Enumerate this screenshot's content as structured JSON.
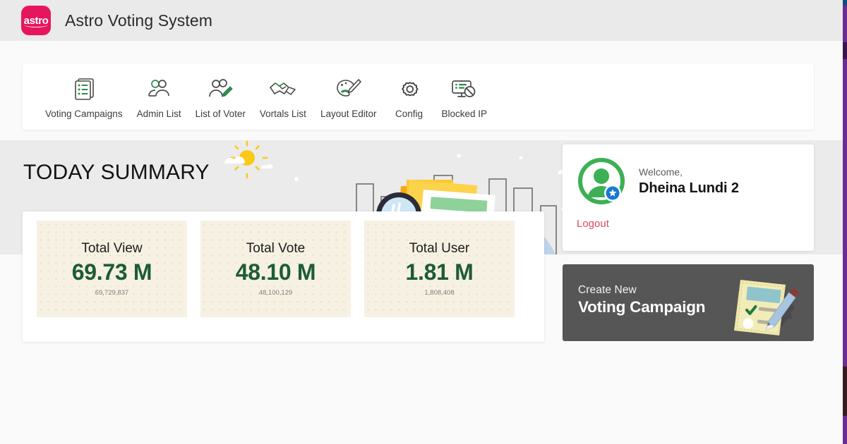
{
  "header": {
    "logo_text": "astro",
    "logo_color": "#e6165e",
    "title": "Astro Voting System"
  },
  "nav": {
    "items": [
      {
        "label": "Voting Campaigns",
        "icon": "documents-list-icon"
      },
      {
        "label": "Admin List",
        "icon": "users-admin-icon"
      },
      {
        "label": "List of Voter",
        "icon": "user-edit-icon"
      },
      {
        "label": "Vortals List",
        "icon": "handshake-icon"
      },
      {
        "label": "Layout Editor",
        "icon": "paint-palette-icon"
      },
      {
        "label": "Config",
        "icon": "gear-icon"
      },
      {
        "label": "Blocked IP",
        "icon": "monitor-blocked-icon"
      }
    ]
  },
  "hero": {
    "title": "TODAY SUMMARY"
  },
  "summary": {
    "stats": [
      {
        "label": "Total View",
        "value": "69.73 M",
        "exact": "69,729,837"
      },
      {
        "label": "Total Vote",
        "value": "48.10 M",
        "exact": "48,100,129"
      },
      {
        "label": "Total User",
        "value": "1.81 M",
        "exact": "1,808,408"
      }
    ],
    "value_color": "#1c5c34",
    "card_bg": "#f6f1e2"
  },
  "welcome": {
    "greeting": "Welcome,",
    "user_name": "Dheina Lundi 2",
    "logout_label": "Logout",
    "logout_color": "#e2485e",
    "avatar_icon": "user-avatar-verified-icon",
    "avatar_color": "#3cb054",
    "badge_color": "#1778d4"
  },
  "create_campaign": {
    "kicker": "Create New",
    "title": "Voting Campaign",
    "panel_color": "#565656",
    "art_icon": "ballot-pencil-icon"
  },
  "edge": {
    "strip_color": "#6b2d91"
  }
}
